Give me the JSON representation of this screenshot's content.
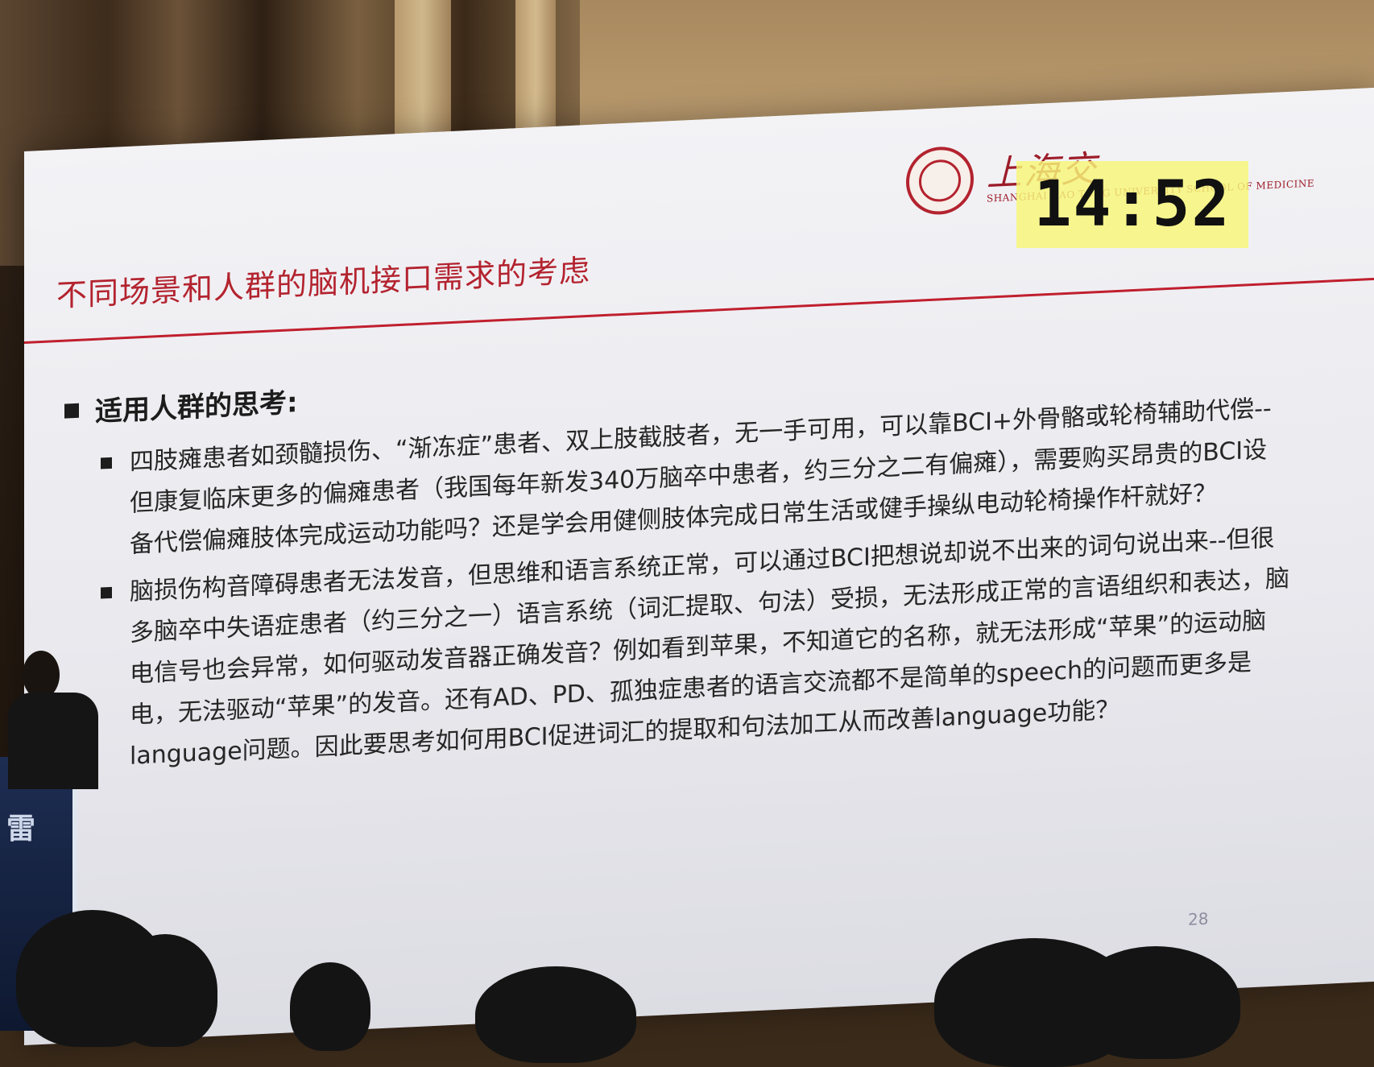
{
  "slide": {
    "title": "不同场景和人群的脑机接口需求的考虑",
    "logo_script": "上海交",
    "logo_english": "SHANGHAI JIAO TONG UNIVERSITY SCHOOL OF MEDICINE",
    "heading": "适用人群的思考:",
    "paragraphs": [
      "四肢瘫患者如颈髓损伤、“渐冻症”患者、双上肢截肢者，无一手可用，可以靠BCI+外骨骼或轮椅辅助代偿--但康复临床更多的偏瘫患者（我国每年新发340万脑卒中患者，约三分之二有偏瘫），需要购买昂贵的BCI设备代偿偏瘫肢体完成运动功能吗？还是学会用健侧肢体完成日常生活或健手操纵电动轮椅操作杆就好？",
      "脑损伤构音障碍患者无法发音，但思维和语言系统正常，可以通过BCI把想说却说不出来的词句说出来--但很多脑卒中失语症患者（约三分之一）语言系统（词汇提取、句法）受损，无法形成正常的言语组织和表达，脑电信号也会异常，如何驱动发音器正确发音？例如看到苹果，不知道它的名称，就无法形成“苹果”的运动脑电，无法驱动“苹果”的发音。还有AD、PD、孤独症患者的语言交流都不是简单的speech的问题而更多是language问题。因此要思考如何用BCI促进词汇的提取和句法加工从而改善language功能？"
    ],
    "page_number": "28"
  },
  "timer": {
    "time": "14:52"
  },
  "podium": {
    "text": "雷"
  },
  "colors": {
    "title_red": "#b3232f",
    "timer_yellow": "#f8f678",
    "text": "#262626"
  }
}
